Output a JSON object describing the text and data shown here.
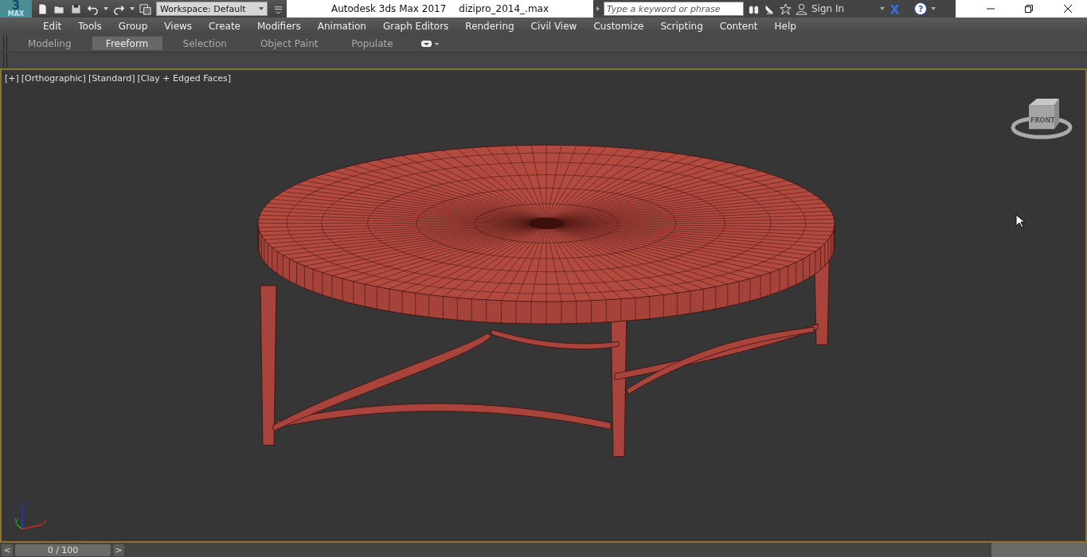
{
  "app": {
    "logo": "3",
    "logo_sub": "MAX"
  },
  "workspace": "Workspace: Default",
  "title": "Autodesk 3ds Max 2017",
  "file": "dizipro_2014_.max",
  "search": {
    "placeholder": "Type a keyword or phrase"
  },
  "sign_in": "Sign In",
  "help": "?",
  "menu": [
    "Edit",
    "Tools",
    "Group",
    "Views",
    "Create",
    "Modifiers",
    "Animation",
    "Graph Editors",
    "Rendering",
    "Civil View",
    "Customize",
    "Scripting",
    "Content",
    "Help"
  ],
  "ribbon_tabs": [
    {
      "label": "Modeling",
      "selected": false
    },
    {
      "label": "Freeform",
      "selected": true
    },
    {
      "label": "Selection",
      "selected": false
    },
    {
      "label": "Object Paint",
      "selected": false
    },
    {
      "label": "Populate",
      "selected": false
    }
  ],
  "viewport": {
    "labels": [
      "[+]",
      "[Orthographic]",
      "[Standard]",
      "[Clay + Edged Faces]"
    ],
    "viewcube_label": "FRONT",
    "axes": [
      "x",
      "y",
      "z"
    ]
  },
  "timeline": {
    "prev": "<",
    "position": "0 / 100",
    "next": ">",
    "level": 0
  }
}
